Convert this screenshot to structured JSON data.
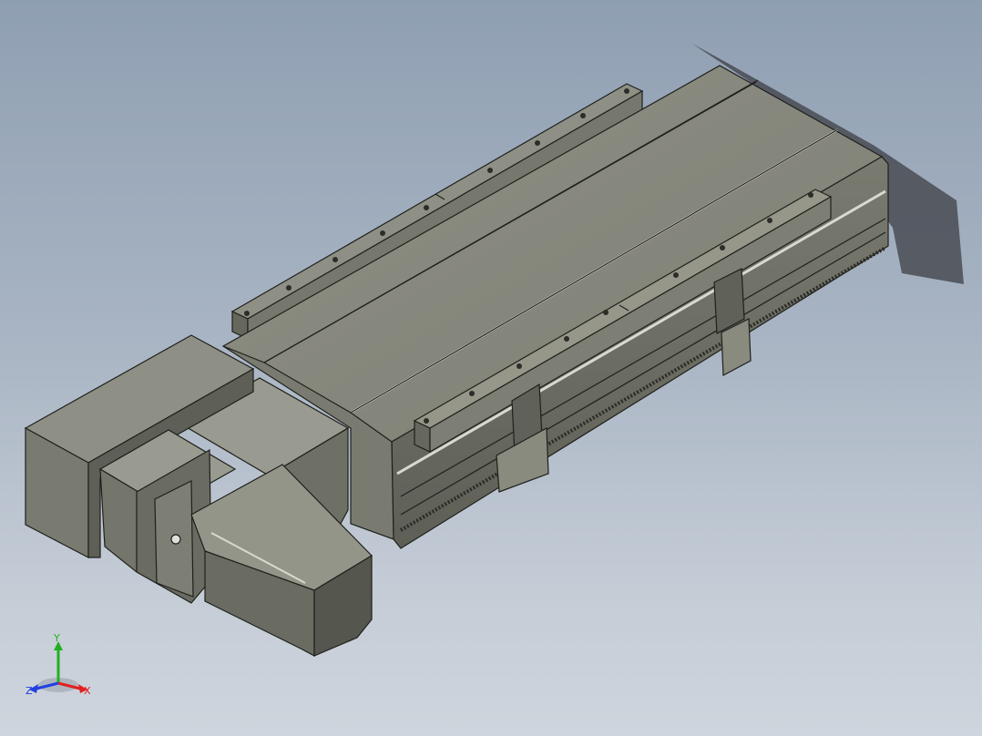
{
  "viewport": {
    "background_top": "#8f9fb2",
    "background_bottom": "#cfd5dd"
  },
  "model": {
    "body_color": "#8a8b7f",
    "shade_color": "#66675d",
    "dark_color": "#4a4b43",
    "highlight_color": "#aeb0a4",
    "edge_color": "#1f201c"
  },
  "triad": {
    "x_label": "X",
    "y_label": "Y",
    "z_label": "Z",
    "x_color": "#e02020",
    "y_color": "#20b020",
    "z_color": "#2040e0"
  }
}
